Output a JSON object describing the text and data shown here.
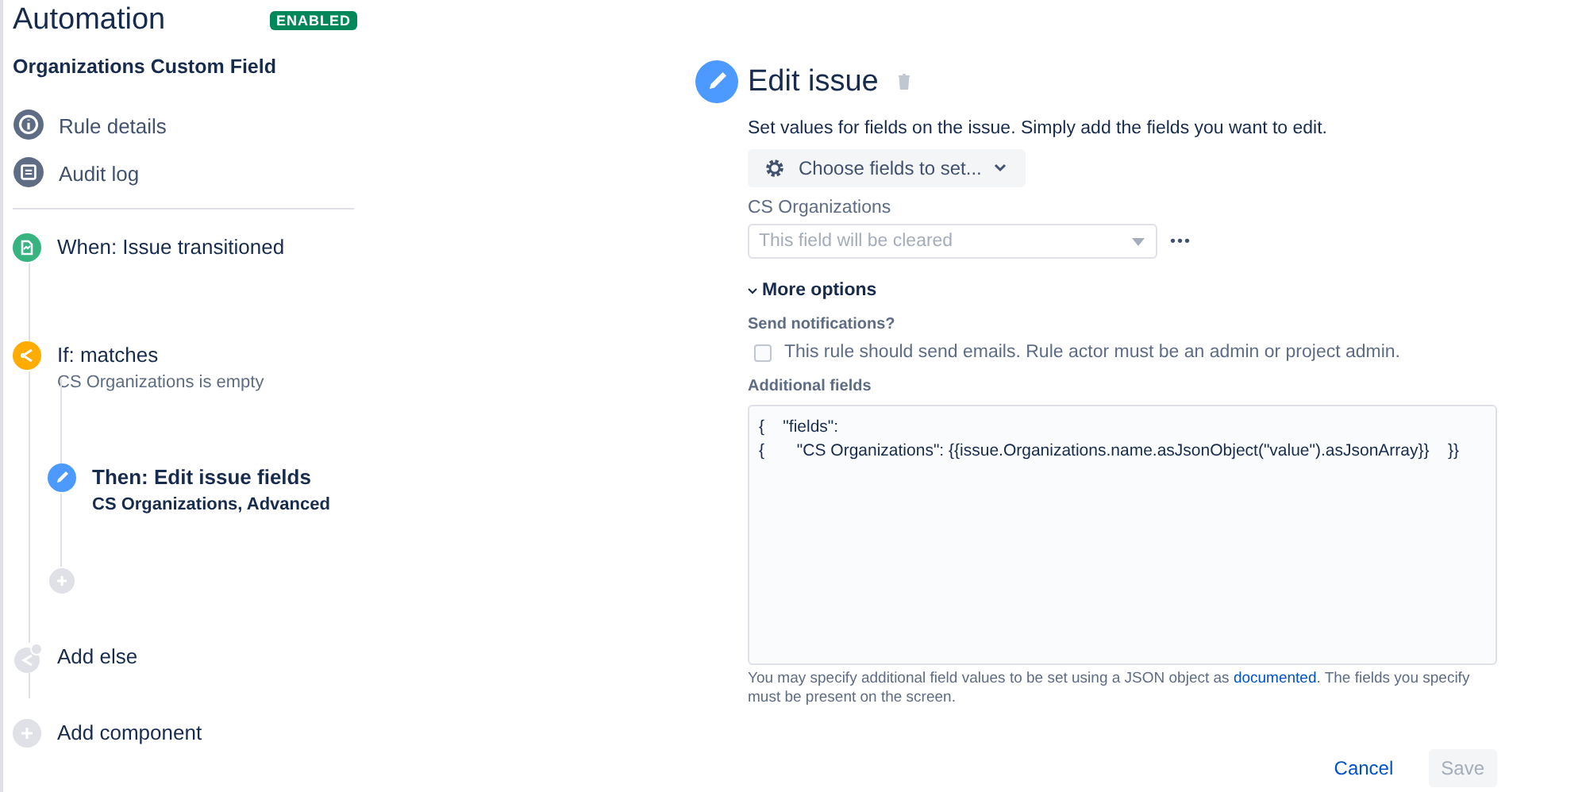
{
  "sidebar": {
    "title": "Automation",
    "status_badge": "ENABLED",
    "rule_name": "Organizations Custom Field",
    "nav": [
      {
        "kind": "info",
        "label": "Rule details"
      },
      {
        "kind": "log",
        "label": "Audit log"
      }
    ],
    "components": [
      {
        "kind": "trigger",
        "title": "When: Issue transitioned",
        "selected": false
      },
      {
        "kind": "condition",
        "title": "If: matches",
        "subtitle": "CS Organizations is empty",
        "selected": false,
        "children": [
          {
            "kind": "action",
            "title": "Then: Edit issue fields",
            "subtitle": "CS Organizations, Advanced",
            "selected": true
          },
          {
            "kind": "add"
          }
        ]
      },
      {
        "kind": "add-else",
        "title": "Add else",
        "selected": false
      },
      {
        "kind": "add-component",
        "title": "Add component",
        "selected": false
      }
    ]
  },
  "editor": {
    "title": "Edit issue",
    "description": "Set values for fields on the issue. Simply add the fields you want to edit.",
    "choose_button": "Choose fields to set...",
    "field": {
      "label": "CS Organizations",
      "placeholder": "This field will be cleared",
      "more": "•••"
    },
    "more_options": {
      "label": "More options",
      "expanded": true
    },
    "notifications": {
      "label": "Send notifications?",
      "text": "This rule should send emails. Rule actor must be an admin or project admin.",
      "checked": false
    },
    "additional": {
      "label": "Additional fields",
      "lines": [
        "{    \"fields\":",
        "{       \"CS Organizations\": {{issue.Organizations.name.asJsonObject(\"value\").asJsonArray}}    }}"
      ],
      "help_before": "You may specify additional field values to be set using a JSON object as ",
      "help_link": "documented",
      "help_after": ". The fields you specify must be present on the screen."
    },
    "buttons": [
      {
        "kind": "link",
        "label": "Cancel",
        "disabled": false
      },
      {
        "kind": "primary",
        "label": "Save",
        "disabled": true
      }
    ]
  }
}
